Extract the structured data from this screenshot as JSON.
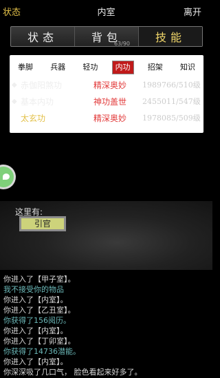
{
  "header": {
    "status": "状态",
    "title": "内室",
    "leave": "离开"
  },
  "main_tabs": [
    {
      "label": "状态"
    },
    {
      "label": "背包",
      "count": "63/90"
    },
    {
      "label": "技能"
    }
  ],
  "sub_tabs": [
    "拳脚",
    "兵器",
    "轻功",
    "内功",
    "招架",
    "知识"
  ],
  "active_sub_tab": "内功",
  "skills": [
    {
      "marker": "◆",
      "name": "赤伽阳煞功",
      "level": "精深奥妙",
      "value": "1989766/510级"
    },
    {
      "marker": "◆",
      "name": "基本内功",
      "level": "神功盖世",
      "value": "2455011/547级"
    },
    {
      "marker": "",
      "name": "太玄功",
      "level": "精深奥妙",
      "value": "1978085/509级"
    }
  ],
  "scene": {
    "label": "这里有:",
    "npc": "引官"
  },
  "log": [
    {
      "text": "你进入了【甲子室】。",
      "color": "white"
    },
    {
      "text": "我不接受你的物品",
      "color": "cyan"
    },
    {
      "text": "你进入了【内室】。",
      "color": "white"
    },
    {
      "text": "你进入了【乙丑室】。",
      "color": "white"
    },
    {
      "text": "你获得了156阅历。",
      "color": "cyan"
    },
    {
      "text": "你进入了【内室】。",
      "color": "white"
    },
    {
      "text": "你进入了【丁卯室】。",
      "color": "white"
    },
    {
      "text": "你获得了14736潜能。",
      "color": "cyan"
    },
    {
      "text": "你进入了【内室】。",
      "color": "white"
    },
    {
      "text": "你深深吸了几口气， 脸色看起来好多了。",
      "color": "white"
    }
  ]
}
